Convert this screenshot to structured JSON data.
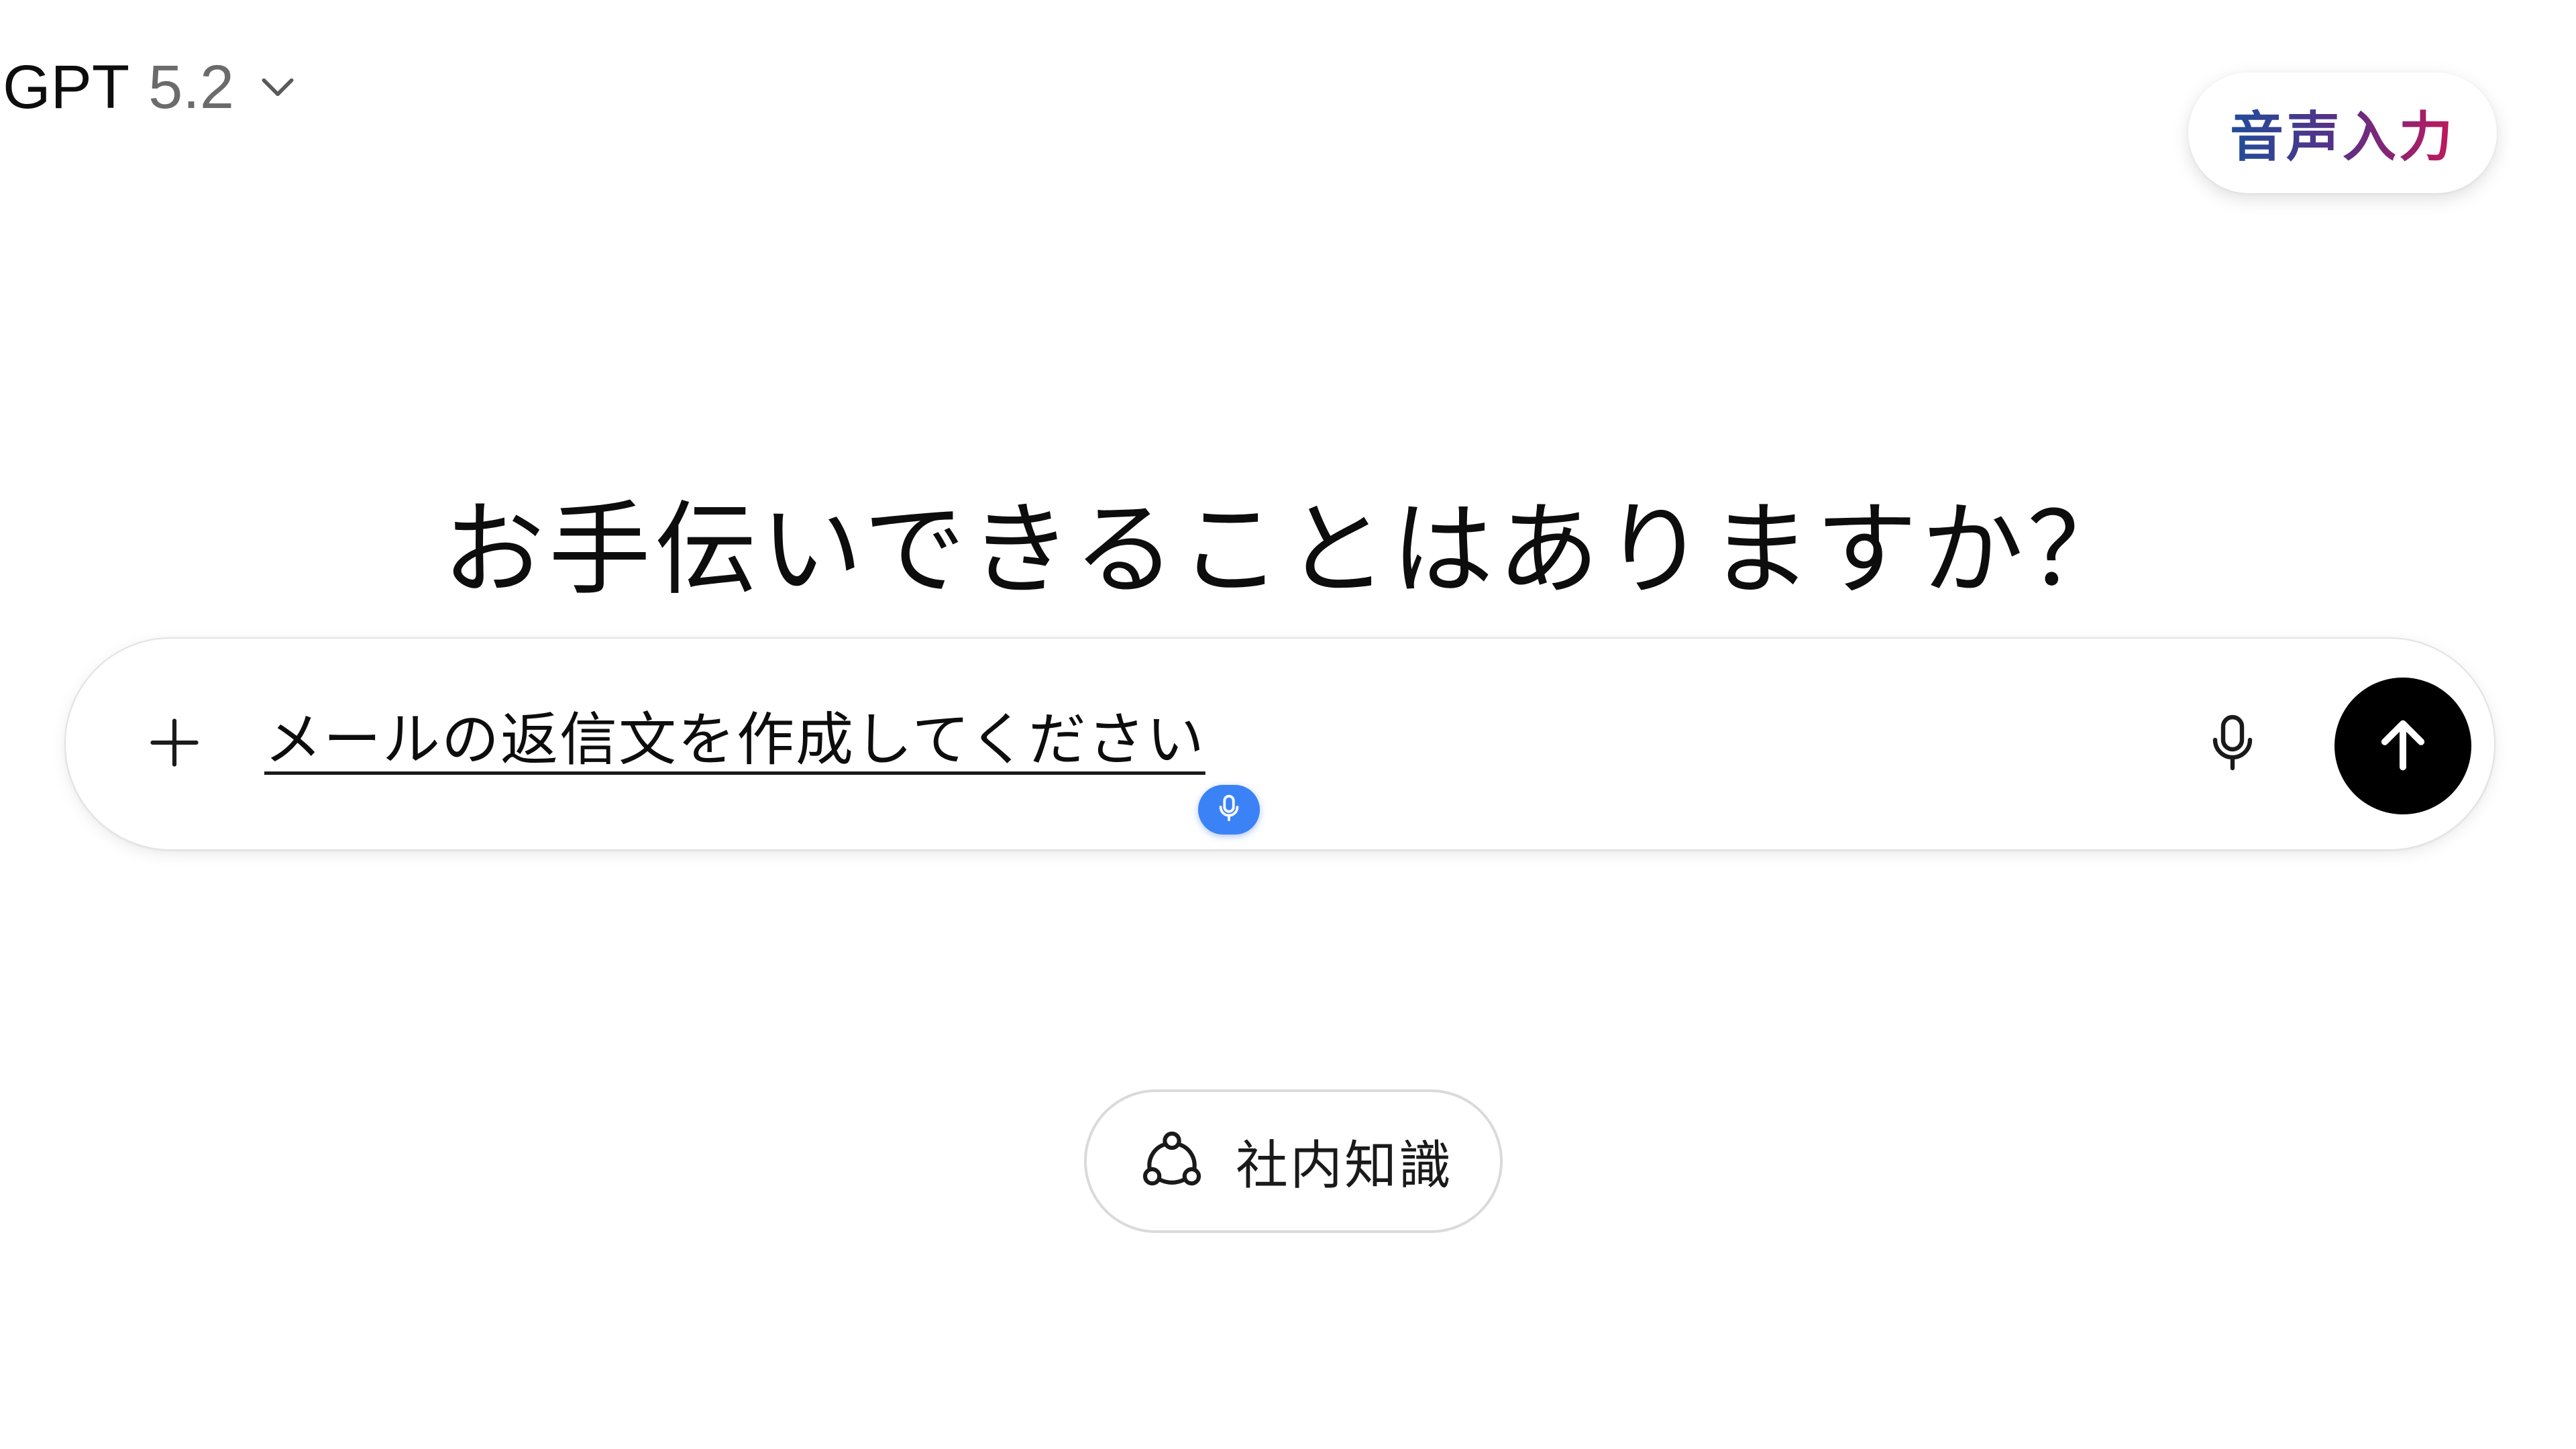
{
  "header": {
    "model_name": "GPT",
    "model_version": "5.2",
    "model_menu_icon": "chevron-down-icon",
    "voice_input_label": "音声入力",
    "voice_input_gradient": [
      "#1f4d9a",
      "#5b2f86",
      "#c2185b"
    ]
  },
  "main": {
    "heading": "お手伝いできることはありますか？"
  },
  "composer": {
    "add_icon": "plus-icon",
    "input_text": "メールの返信文を作成してください",
    "dictation_icon": "microphone-icon",
    "dictation_color": "#3b82f6",
    "mic_icon": "microphone-icon",
    "send_icon": "arrow-up-icon",
    "send_color": "#000000"
  },
  "chips": {
    "knowledge_icon": "connected-nodes-icon",
    "knowledge_label": "社内知識"
  }
}
